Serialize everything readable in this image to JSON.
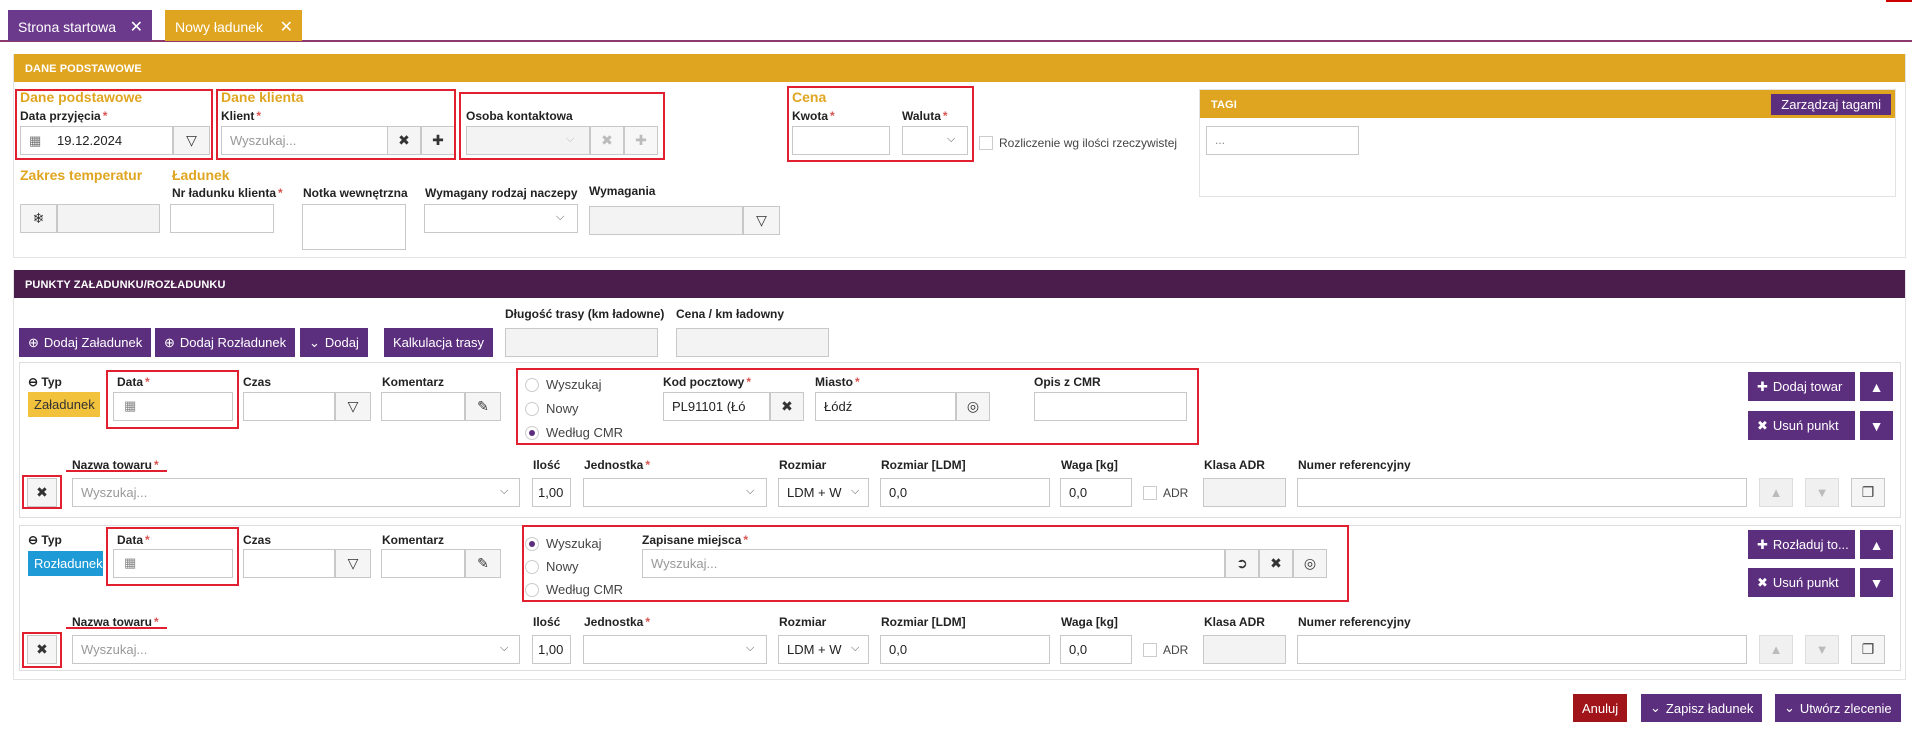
{
  "tabs": [
    {
      "label": "Strona startowa",
      "close": "✕"
    },
    {
      "label": "Nowy ładunek",
      "close": "✕"
    }
  ],
  "colors": {
    "purple": "#5c2e7e",
    "gold": "#e0a520",
    "darkpurple": "#4a1d4c",
    "tab_start": "#6b3a8c",
    "red_cancel": "#a0141a",
    "blue": "#1e9ad6"
  },
  "basic": {
    "header": "DANE PODSTAWOWE",
    "sec_basic": "Dane podstawowe",
    "date_label": "Data przyjęcia",
    "date_value": "19.12.2024",
    "sec_client": "Dane klienta",
    "client_label": "Klient",
    "client_placeholder": "Wyszukaj...",
    "contact_label": "Osoba kontaktowa",
    "sec_price": "Cena",
    "amount_label": "Kwota",
    "currency_label": "Waluta",
    "settle_label": "Rozliczenie wg ilości rzeczywistej",
    "tags_header": "TAGI",
    "tags_button": "Zarządzaj tagami",
    "tags_placeholder": "...",
    "sec_temp": "Zakres temperatur",
    "sec_load": "Ładunek",
    "clientno_label": "Nr ładunku klienta",
    "note_label": "Notka wewnętrzna",
    "trailer_label": "Wymagany rodzaj naczepy",
    "req_label": "Wymagania"
  },
  "points": {
    "header": "PUNKTY ZAŁADUNKU/ROZŁADUNKU",
    "route_len_label": "Długość trasy (km ładowne)",
    "price_km_label": "Cena / km ładowny",
    "btn_add_load": "Dodaj Załadunek",
    "btn_add_unload": "Dodaj Rozładunek",
    "btn_add": "Dodaj",
    "btn_calc": "Kalkulacja trasy",
    "type_label": "Typ",
    "date_label": "Data",
    "time_label": "Czas",
    "comment_label": "Komentarz",
    "load_badge": "Załadunek",
    "unload_badge": "Rozładunek",
    "radio_search": "Wyszukaj",
    "radio_new": "Nowy",
    "radio_cmr": "Według CMR",
    "postal_label": "Kod pocztowy",
    "postal_value": "PL91101 (Łó",
    "city_label": "Miasto",
    "city_value": "Łódź",
    "cmr_desc_label": "Opis z CMR",
    "saved_label": "Zapisane miejsca",
    "saved_placeholder": "Wyszukaj...",
    "btn_add_goods": "Dodaj towar",
    "btn_remove_point": "Usuń punkt",
    "btn_unload_to": "Rozładuj to...",
    "goods_name_label": "Nazwa towaru",
    "goods_placeholder": "Wyszukaj...",
    "qty_label": "Ilość",
    "qty_value": "1,00",
    "unit_label": "Jednostka",
    "size_label": "Rozmiar",
    "size_value": "LDM + W",
    "ldm_label": "Rozmiar [LDM]",
    "ldm_value": "0,0",
    "weight_label": "Waga [kg]",
    "weight_value": "0,0",
    "adr_label": "ADR",
    "adr_class_label": "Klasa ADR",
    "ref_label": "Numer referencyjny"
  },
  "footer": {
    "cancel": "Anuluj",
    "save": "Zapisz ładunek",
    "create": "Utwórz zlecenie"
  },
  "icons": {
    "close": "close-icon",
    "calendar": "calendar-icon",
    "filter": "filter-icon",
    "plus": "plus-icon",
    "snowflake": "snowflake-icon",
    "compass": "compass-icon",
    "edit": "edit-icon",
    "arrow-up": "arrow-up-icon",
    "arrow-down": "arrow-down-icon",
    "copy": "copy-icon",
    "chevron": "chevron-down-icon",
    "circle-plus": "circle-plus-icon",
    "goto": "arrow-circle-icon"
  }
}
